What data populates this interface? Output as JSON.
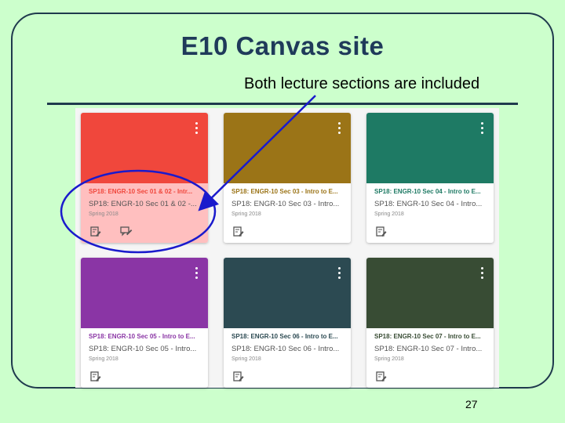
{
  "slide": {
    "title": "E10 Canvas site",
    "subtitle": "Both lecture sections are included",
    "page_number": "27"
  },
  "colors": {
    "background": "#ccffcc",
    "annotation": "#1a1acc",
    "highlight": "#ffbfbf"
  },
  "cards": [
    {
      "title": "SP18: ENGR-10 Sec 01 & 02 - Intr...",
      "subtitle": "SP18: ENGR-10 Sec 01 & 02 -...",
      "term": "Spring 2018",
      "color": "#f0473c",
      "icons": [
        "assignments-icon",
        "discussions-icon"
      ],
      "highlighted": true
    },
    {
      "title": "SP18: ENGR-10 Sec 03 - Intro to E...",
      "subtitle": "SP18: ENGR-10 Sec 03 - Intro...",
      "term": "Spring 2018",
      "color": "#9b7417",
      "icons": [
        "assignments-icon"
      ],
      "highlighted": false
    },
    {
      "title": "SP18: ENGR-10 Sec 04 - Intro to E...",
      "subtitle": "SP18: ENGR-10 Sec 04 - Intro...",
      "term": "Spring 2018",
      "color": "#1e7a64",
      "icons": [
        "assignments-icon"
      ],
      "highlighted": false
    },
    {
      "title": "SP18: ENGR-10 Sec 05 - Intro to E...",
      "subtitle": "SP18: ENGR-10 Sec 05 - Intro...",
      "term": "Spring 2018",
      "color": "#8a35a5",
      "icons": [
        "assignments-icon"
      ],
      "highlighted": false
    },
    {
      "title": "SP18: ENGR-10 Sec 06 - Intro to E...",
      "subtitle": "SP18: ENGR-10 Sec 06 - Intro...",
      "term": "Spring 2018",
      "color": "#2c4a52",
      "icons": [
        "assignments-icon"
      ],
      "highlighted": false
    },
    {
      "title": "SP18: ENGR-10 Sec 07 - Intro to E...",
      "subtitle": "SP18: ENGR-10 Sec 07 - Intro...",
      "term": "Spring 2018",
      "color": "#384c34",
      "icons": [
        "assignments-icon"
      ],
      "highlighted": false
    }
  ]
}
